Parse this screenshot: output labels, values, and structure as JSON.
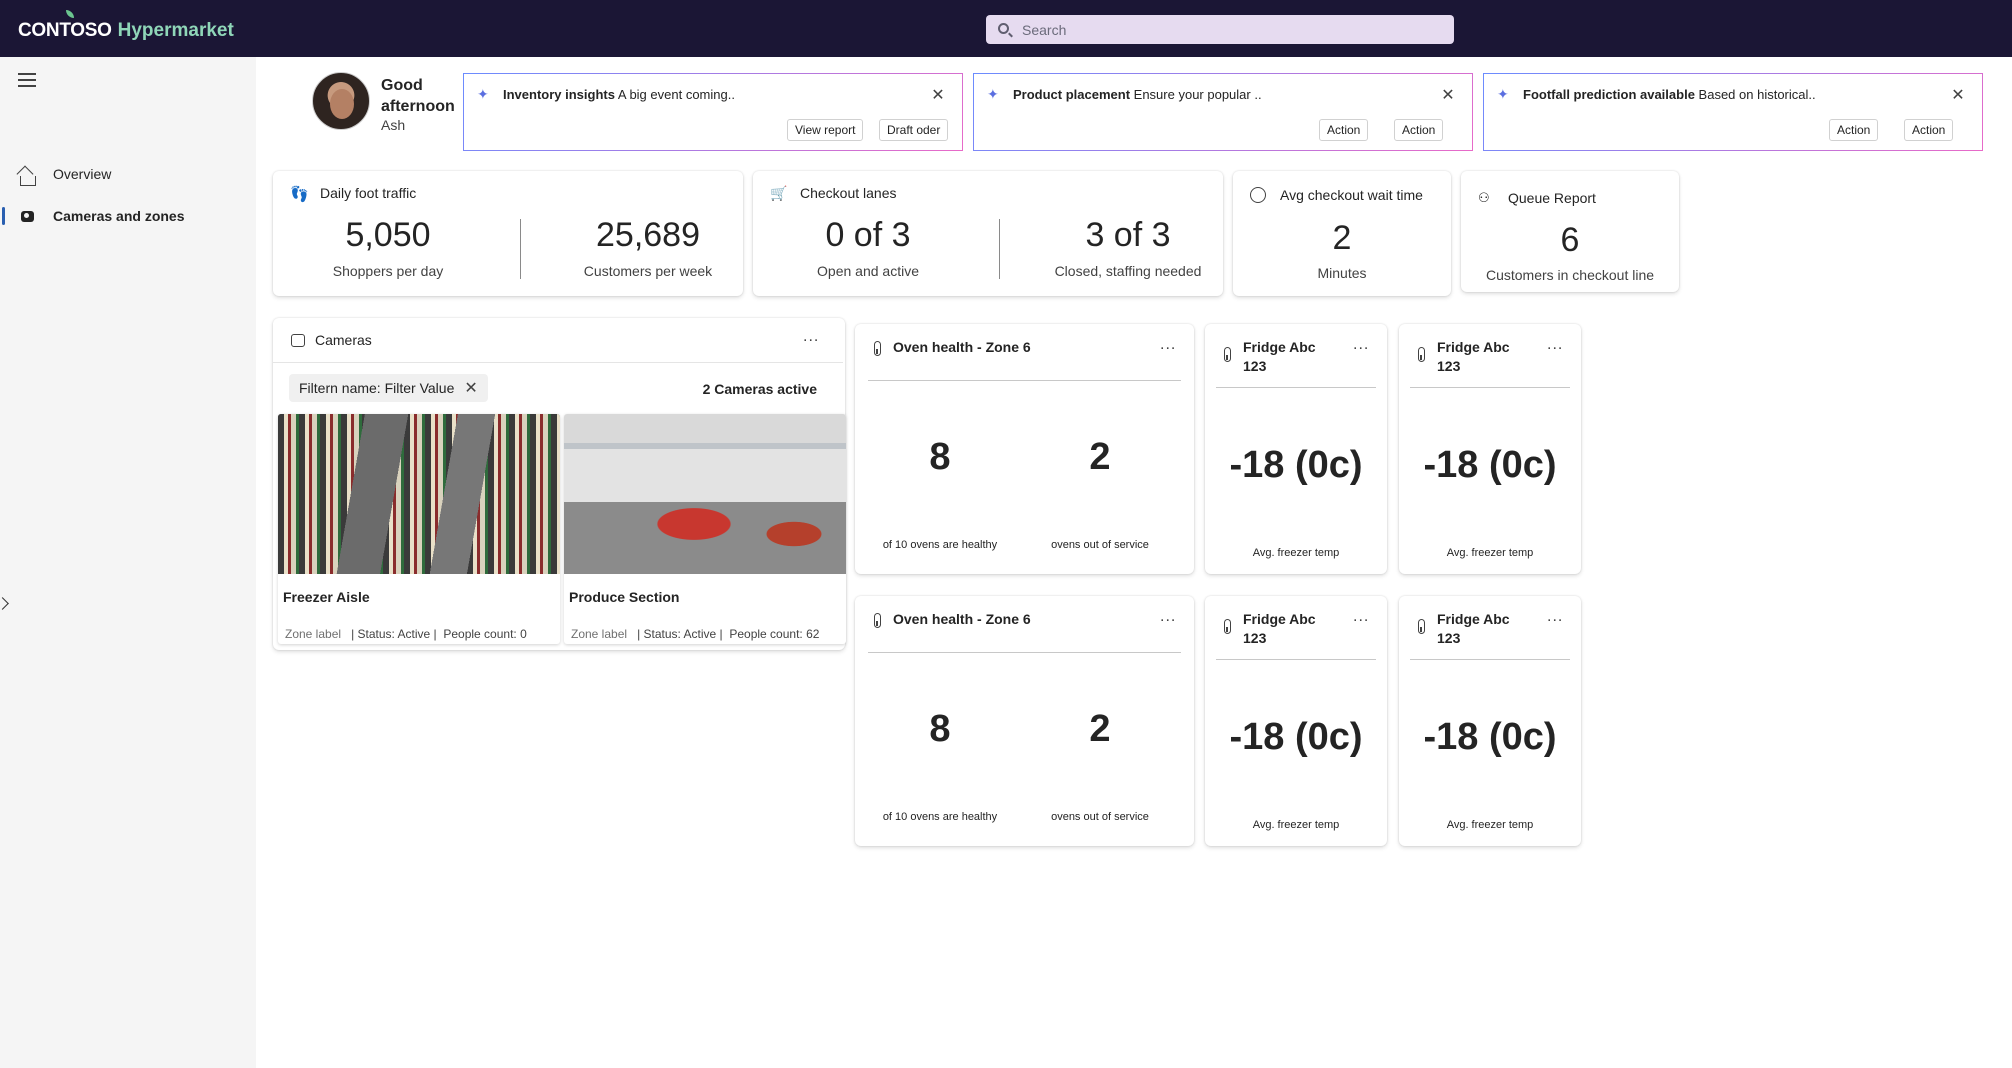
{
  "app": {
    "brand_main": "CONTOSO",
    "brand_sub": "Hypermarket"
  },
  "search": {
    "placeholder": "Search"
  },
  "sidebar": {
    "items": [
      {
        "label": "Overview",
        "icon": "home-icon"
      },
      {
        "label": "Cameras and zones",
        "icon": "camera-icon",
        "active": true
      }
    ]
  },
  "greeting": {
    "line": "Good afternoon",
    "name": "Ash"
  },
  "insights": [
    {
      "title": "Inventory insights",
      "text": "A big event coming..",
      "buttons": [
        "View report",
        "Draft oder"
      ]
    },
    {
      "title": "Product placement",
      "text": "Ensure your popular ..",
      "buttons": [
        "Action",
        "Action"
      ]
    },
    {
      "title": "Footfall prediction available",
      "text": "Based on historical..",
      "buttons": [
        "Action",
        "Action"
      ]
    }
  ],
  "kpis": {
    "foot_traffic": {
      "title": "Daily foot traffic",
      "v1": "5,050",
      "l1": "Shoppers per day",
      "v2": "25,689",
      "l2": "Customers per week"
    },
    "checkout": {
      "title": "Checkout lanes",
      "v1": "0 of 3",
      "l1": "Open and active",
      "v2": "3 of 3",
      "l2": "Closed, staffing needed"
    },
    "wait": {
      "title": "Avg checkout wait time",
      "value": "2",
      "label": "Minutes"
    },
    "queue": {
      "title": "Queue Report",
      "value": "6",
      "label": "Customers in checkout line"
    }
  },
  "cameras": {
    "title": "Cameras",
    "more": "...",
    "filter": "Filtern name: Filter Value",
    "active_count": "2 Cameras active",
    "tiles": [
      {
        "name": "Freezer Aisle",
        "zone": "Zone label",
        "status": "| Status: Active |",
        "people": "People count: 0"
      },
      {
        "name": "Produce Section",
        "zone": "Zone label",
        "status": "| Status: Active |",
        "people": "People count: 62"
      }
    ]
  },
  "ovens": [
    {
      "title": "Oven health - Zone 6",
      "healthy": "8",
      "healthy_label": "of 10 ovens are healthy",
      "out": "2",
      "out_label": "ovens out of service"
    },
    {
      "title": "Oven health - Zone 6",
      "healthy": "8",
      "healthy_label": "of 10 ovens are healthy",
      "out": "2",
      "out_label": "ovens out of service"
    }
  ],
  "fridges": [
    {
      "title_line1": "Fridge Abc",
      "title_line2": "123",
      "value": "-18 (0c)",
      "label": "Avg. freezer temp"
    },
    {
      "title_line1": "Fridge Abc",
      "title_line2": "123",
      "value": "-18 (0c)",
      "label": "Avg. freezer temp"
    },
    {
      "title_line1": "Fridge Abc",
      "title_line2": "123",
      "value": "-18 (0c)",
      "label": "Avg. freezer temp"
    },
    {
      "title_line1": "Fridge Abc",
      "title_line2": "123",
      "value": "-18 (0c)",
      "label": "Avg. freezer temp"
    }
  ],
  "colors": {
    "topbar": "#1b1635",
    "accent": "#2a5fb0",
    "brand_sub": "#8fd6b8"
  }
}
